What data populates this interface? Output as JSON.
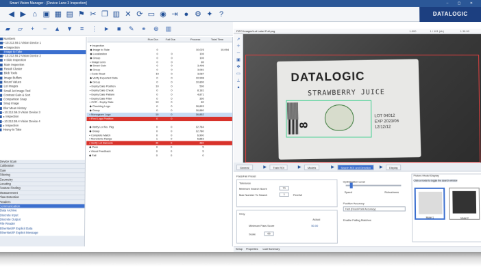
{
  "title_bar": {
    "text": "Smart Vision Manager - [Device Lane 3 Inspection]",
    "controls": "–  ▢  ✕"
  },
  "brand": "DATALOGIC",
  "toolbar_main": {
    "icons": [
      "back-icon",
      "forward-icon",
      "home-icon",
      "image-icon",
      "grid-icon",
      "save-icon",
      "pin-icon",
      "cut-icon",
      "copy-icon",
      "paste-icon",
      "delete-icon",
      "refresh-icon",
      "monitor-icon",
      "capture-icon",
      "step-icon",
      "record-icon",
      "settings-icon",
      "stats-icon",
      "help-icon"
    ]
  },
  "toolbar_tree": {
    "icons": [
      "folder-icon",
      "open-icon",
      "add-icon",
      "remove-icon",
      "up-icon",
      "down-icon",
      "list-icon",
      "tree-icon",
      "run-icon",
      "stop-icon",
      "tool-icon",
      "link-icon",
      "target-icon",
      "chart-icon"
    ]
  },
  "tree": {
    "items": [
      {
        "label": "Numbers",
        "selected": false
      },
      {
        "label": "▪ 10.212.59.1 Vision Device 1",
        "selected": false
      },
      {
        "label": "  ▾ Inspection",
        "selected": false
      },
      {
        "label": "      Image to Take",
        "selected": true
      },
      {
        "label": "▪ 10.212.59.2 Vision Device 2",
        "selected": false
      },
      {
        "label": "  ▾ Side Inspection",
        "selected": false
      },
      {
        "label": "      Main Inspection",
        "selected": false
      },
      {
        "label": "      Result Cluster",
        "selected": false
      },
      {
        "label": "      Blob Tools",
        "selected": false
      },
      {
        "label": "      Image Buffers",
        "selected": false
      },
      {
        "label": "      Mount Values",
        "selected": false
      },
      {
        "label": "      Lot Images",
        "selected": false
      },
      {
        "label": "      Small Jet Image Tool",
        "selected": false
      },
      {
        "label": "      Contrast Gain & Sort",
        "selected": false
      },
      {
        "label": "      Comparison Snap",
        "selected": false
      },
      {
        "label": "      Snap Image",
        "selected": false
      },
      {
        "label": "      Blur Mean History",
        "selected": false
      },
      {
        "label": "▪ 10.212.59.3 Vision Device 3",
        "selected": false
      },
      {
        "label": "  ▸ Inspection",
        "selected": false
      },
      {
        "label": "▪ 10.212.59.4 Vision Device 4",
        "selected": false
      },
      {
        "label": "  ▸ Inspection",
        "selected": false
      },
      {
        "label": "      Heavy to Take",
        "selected": false
      }
    ]
  },
  "grid": {
    "columns": [
      "Run Dur.",
      "Fail Dur.",
      "Process",
      "Total Time"
    ],
    "rows": [
      {
        "name": "▾ Inspection",
        "c1": "",
        "c2": "",
        "c3": "",
        "c4": "",
        "style": ""
      },
      {
        "name": "  ◆ Image to Take",
        "c1": "0",
        "c2": "",
        "c3": "10,023",
        "c4": "10,094",
        "style": ""
      },
      {
        "name": "    ◆ Localization",
        "c1": "0",
        "c2": "0",
        "c3": "100",
        "c4": "",
        "style": ""
      },
      {
        "name": "      ◆ Group",
        "c1": "0",
        "c2": "0",
        "c3": "100",
        "c4": "",
        "style": ""
      },
      {
        "name": "        ▪ Image Lens",
        "c1": "0",
        "c2": "0",
        "c3": "80",
        "c4": "",
        "style": ""
      },
      {
        "name": "    ◆ Smart Gain",
        "c1": "0",
        "c2": "0",
        "c3": "3,496",
        "c4": "",
        "style": ""
      },
      {
        "name": "      ◆ Group",
        "c1": "0",
        "c2": "0",
        "c3": "3,081",
        "c4": "",
        "style": ""
      },
      {
        "name": "        ▪ Code Read",
        "c1": "10",
        "c2": "0",
        "c3": "3,087",
        "c4": "",
        "style": ""
      },
      {
        "name": "    ◆ Verify Expected Data",
        "c1": "0",
        "c2": "0",
        "c3": "10,998",
        "c4": "",
        "style": ""
      },
      {
        "name": "      ◆ Group",
        "c1": "0",
        "c2": "0",
        "c3": "10,800",
        "c4": "",
        "style": ""
      },
      {
        "name": "        ▪ Expiry Date Position",
        "c1": "10",
        "c2": "0",
        "c3": "500",
        "c4": "",
        "style": ""
      },
      {
        "name": "        ▪ Expiry Date Check",
        "c1": "0",
        "c2": "0",
        "c3": "8,181",
        "c4": "",
        "style": ""
      },
      {
        "name": "        ▪ Expiry Date Pattern",
        "c1": "0",
        "c2": "0",
        "c3": "4,871",
        "c4": "",
        "style": ""
      },
      {
        "name": "        ▪ Expiry Date Filter",
        "c1": "0",
        "c2": "0",
        "c3": "300",
        "c4": "",
        "style": ""
      },
      {
        "name": "        ▪ OCR - Expiry Date",
        "c1": "10",
        "c2": "0",
        "c3": "80",
        "c4": "",
        "style": ""
      },
      {
        "name": "    ◆ Checking Logo",
        "c1": "0",
        "c2": "0",
        "c3": "16,893",
        "c4": "",
        "style": ""
      },
      {
        "name": "      ◆ Group",
        "c1": "0",
        "c2": "0",
        "c3": "16,880",
        "c4": "",
        "style": ""
      },
      {
        "name": "        ▪ Monogram Logo",
        "c1": "10",
        "c2": "0",
        "c3": "16,852",
        "c4": "",
        "style": "lb"
      },
      {
        "name": "        ▪ Find Logo Position",
        "c1": "0",
        "c2": "0",
        "c3": "",
        "c4": "",
        "style": "hl"
      },
      {
        "name": "",
        "c1": "",
        "c2": "",
        "c3": "",
        "c4": "",
        "style": ""
      },
      {
        "name": "    ◆ Verify Lot No. Pkg",
        "c1": "0",
        "c2": "0",
        "c3": "12,784",
        "c4": "",
        "style": ""
      },
      {
        "name": "      ◆ Group",
        "c1": "0",
        "c2": "0",
        "c3": "12,780",
        "c4": "",
        "style": ""
      },
      {
        "name": "        ▪ Complete Match",
        "c1": "0",
        "c2": "0",
        "c3": "6,900",
        "c4": "",
        "style": ""
      },
      {
        "name": "        ▪ Monotonic Range",
        "c1": "1",
        "c2": "0",
        "c3": "5,883",
        "c4": "",
        "style": ""
      },
      {
        "name": "    ▪ Verify Lot Barcode",
        "c1": "40",
        "c2": "0",
        "c3": "480",
        "c4": "",
        "style": "hl"
      },
      {
        "name": "    ◆ Pass",
        "c1": "0",
        "c2": "0",
        "c3": "5",
        "c4": "",
        "style": ""
      },
      {
        "name": "      ▪ Visual Feedback",
        "c1": "0",
        "c2": "0",
        "c3": "5",
        "c4": "",
        "style": ""
      },
      {
        "name": "    ◆ Fail",
        "c1": "0",
        "c2": "0",
        "c3": "0",
        "c4": "",
        "style": ""
      }
    ]
  },
  "nav": {
    "sections": [
      "Device Scan",
      "Calibration",
      "Gain",
      "Filtering",
      "Geometry",
      "Locating",
      "Feature Finding",
      "Measurement",
      "Flaw Detection",
      "Readers",
      "Communication"
    ],
    "selected": "Communication",
    "links": [
      "Data Archive",
      "Discrete Input",
      "Discrete Output",
      "File Reader",
      "EtherNet/IP Explicit Data",
      "EtherNet/IP Explicit Message"
    ]
  },
  "viewer": {
    "tab": "FIFO Images\\Lot Label Full.png",
    "zoom": [
      "1.000",
      "1 / 101 (dir)",
      "1 30.00"
    ]
  },
  "label": {
    "logo": "DATALOGIC",
    "product": "STRAWBERRY  JUICE",
    "number": "8",
    "side_lines": [
      "LOT 04012",
      "EXP 2023/06",
      "12/12/12"
    ]
  },
  "bottom_tabs": [
    {
      "label": "General",
      "selected": false
    },
    {
      "label": "Train ROI",
      "selected": false
    },
    {
      "label": "Models",
      "selected": false
    },
    {
      "label": "Search ROI and Direction",
      "selected": true
    },
    {
      "label": "Display",
      "selected": false
    }
  ],
  "params": {
    "tabs_small": "Pass/Fail  Preset",
    "tolerance_title": "Tolerance",
    "min_score_label": "Minimum Search Score",
    "min_score_value": "70",
    "max_found_label": "Max Number To Search",
    "max_found_value": "1",
    "find_all": "Find All",
    "gray_title": "Gray",
    "actual_label": "Actual",
    "min_pass_label": "Minimum Pass Score",
    "min_pass_value": "50.00",
    "scale_label": "Scale",
    "scale_value": "66",
    "optimization_label": "Optimization Level",
    "speed": "Speed",
    "robustness": "Robustness",
    "accuracy_label": "Position Accuracy",
    "accuracy_value": "Fast (Fixed-Point Accuracy)",
    "falling_edge": "Enable Falling Matches"
  },
  "thumbs": {
    "title": "Picture Model Display",
    "hint": "Click a model to toggle the search window",
    "items": [
      "Model 1",
      "Model 2"
    ]
  },
  "status_tabs": [
    "Setup",
    "Properties",
    "Last Summary"
  ]
}
